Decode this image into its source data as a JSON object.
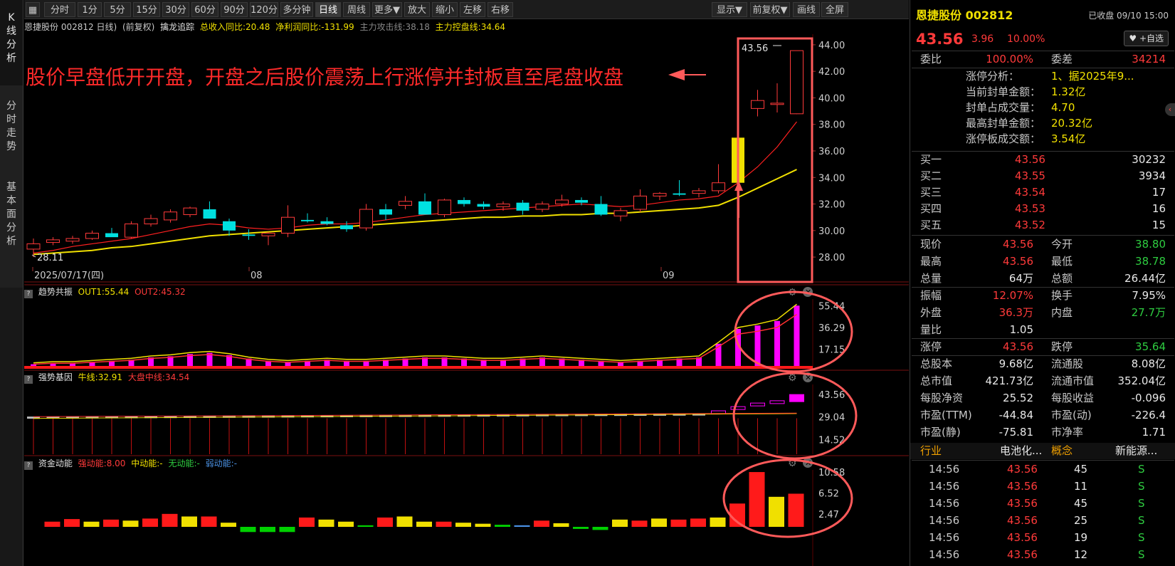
{
  "side_tabs": [
    {
      "label": "K线分析",
      "chars": [
        "K",
        "线",
        "分",
        "析"
      ]
    },
    {
      "label": "分时走势",
      "chars": [
        "分",
        "时",
        "走",
        "势"
      ]
    },
    {
      "label": "基本面分析",
      "chars": [
        "基",
        "本",
        "面",
        "分",
        "析"
      ]
    }
  ],
  "toolbar": {
    "left": [
      "分时",
      "1分",
      "5分",
      "15分",
      "30分",
      "60分",
      "90分",
      "120分",
      "多分钟",
      "日线",
      "周线",
      "更多▼",
      "放大",
      "缩小",
      "左移",
      "右移"
    ],
    "right": [
      "显示▼",
      "前复权▼",
      "画线",
      "全屏"
    ],
    "active": "日线"
  },
  "main_info": {
    "name": "恩捷股份 002812 日线)",
    "fq": "(前复权)",
    "indicator": "擒龙追踪",
    "revenue": "总收入同比:20.48",
    "profit": "净利润同比:-131.99",
    "attack": "主力攻击线:38.18",
    "control": "主力控盘线:34.64"
  },
  "annotation": "股价早盘低开开盘，开盘之后股价震荡上行涨停并封板直至尾盘收盘",
  "kline": {
    "y_ticks": [
      "44.00",
      "42.00",
      "40.00",
      "38.00",
      "36.00",
      "34.00",
      "32.00",
      "30.00",
      "28.00"
    ],
    "x_labels": [
      "2025/07/17(四)",
      "08",
      "09"
    ],
    "low_label": "28.11",
    "high_label": "43.56",
    "candles": [
      [
        28.6,
        29.4,
        28.0,
        29.0
      ],
      [
        29.1,
        29.5,
        28.9,
        29.3
      ],
      [
        29.2,
        29.6,
        29.0,
        29.4
      ],
      [
        29.4,
        30.0,
        29.3,
        29.8
      ],
      [
        29.8,
        30.2,
        29.6,
        29.5
      ],
      [
        29.5,
        30.7,
        29.4,
        30.5
      ],
      [
        30.5,
        31.2,
        30.3,
        30.9
      ],
      [
        30.8,
        31.6,
        30.6,
        31.4
      ],
      [
        31.2,
        31.8,
        31.0,
        31.7
      ],
      [
        31.6,
        32.2,
        31.4,
        30.9
      ],
      [
        30.7,
        30.9,
        29.6,
        30.0
      ],
      [
        29.7,
        30.1,
        29.3,
        29.6
      ],
      [
        29.6,
        29.9,
        28.9,
        29.8
      ],
      [
        29.8,
        31.9,
        29.5,
        31.0
      ],
      [
        30.8,
        31.3,
        30.6,
        30.7
      ],
      [
        30.7,
        31.0,
        30.4,
        30.5
      ],
      [
        30.4,
        30.7,
        29.9,
        30.1
      ],
      [
        30.2,
        32.0,
        30.0,
        31.6
      ],
      [
        31.6,
        32.0,
        30.8,
        31.2
      ],
      [
        31.9,
        32.6,
        31.6,
        32.2
      ],
      [
        32.2,
        32.8,
        31.5,
        31.2
      ],
      [
        31.2,
        32.4,
        31.0,
        32.3
      ],
      [
        32.3,
        32.5,
        31.8,
        32.0
      ],
      [
        32.0,
        32.2,
        31.6,
        31.8
      ],
      [
        31.8,
        32.2,
        31.5,
        32.0
      ],
      [
        32.1,
        32.3,
        31.2,
        31.5
      ],
      [
        31.6,
        32.2,
        31.4,
        32.0
      ],
      [
        32.0,
        32.7,
        31.8,
        32.3
      ],
      [
        32.3,
        32.5,
        31.9,
        32.1
      ],
      [
        32.0,
        32.6,
        31.1,
        31.2
      ],
      [
        31.1,
        31.7,
        30.7,
        31.5
      ],
      [
        31.6,
        33.1,
        31.4,
        32.6
      ],
      [
        32.6,
        32.9,
        32.3,
        32.8
      ],
      [
        32.8,
        33.8,
        32.6,
        32.7
      ],
      [
        32.8,
        33.2,
        32.5,
        33.0
      ],
      [
        33.0,
        35.0,
        32.8,
        33.6
      ],
      [
        33.6,
        37.0,
        33.5,
        37.0
      ],
      [
        39.2,
        40.6,
        38.6,
        39.8
      ],
      [
        39.5,
        41.1,
        38.9,
        39.6
      ],
      [
        38.8,
        43.56,
        38.78,
        43.56
      ]
    ],
    "ma_red": [
      28.3,
      28.5,
      28.8,
      29.0,
      29.2,
      29.4,
      29.7,
      30.0,
      30.3,
      30.5,
      30.4,
      30.2,
      30.1,
      30.2,
      30.4,
      30.5,
      30.5,
      30.6,
      30.8,
      31.0,
      31.2,
      31.3,
      31.4,
      31.5,
      31.6,
      31.7,
      31.8,
      31.9,
      32.0,
      31.9,
      31.8,
      31.9,
      32.1,
      32.3,
      32.4,
      32.6,
      33.6,
      34.8,
      36.3,
      38.2
    ],
    "ma_yellow": [
      28.2,
      28.3,
      28.4,
      28.5,
      28.7,
      28.8,
      29.0,
      29.2,
      29.4,
      29.6,
      29.7,
      29.8,
      29.9,
      30.0,
      30.1,
      30.2,
      30.3,
      30.4,
      30.5,
      30.6,
      30.7,
      30.8,
      30.9,
      31.0,
      31.0,
      31.1,
      31.1,
      31.2,
      31.2,
      31.3,
      31.3,
      31.4,
      31.5,
      31.6,
      31.7,
      31.9,
      32.5,
      33.2,
      33.9,
      34.6
    ]
  },
  "sub1": {
    "name": "趋势共振",
    "out1": "OUT1:55.44",
    "out2": "OUT2:45.32",
    "ticks": [
      "55.44",
      "36.29",
      "17.15"
    ],
    "values": [
      4,
      5,
      5,
      6,
      7,
      8,
      10,
      11,
      13,
      14,
      12,
      9,
      7,
      6,
      7,
      8,
      7,
      7,
      8,
      9,
      10,
      10,
      9,
      8,
      8,
      9,
      10,
      9,
      8,
      7,
      6,
      7,
      8,
      9,
      10,
      22,
      35,
      38,
      42,
      55.44
    ]
  },
  "sub2": {
    "name": "强势基因",
    "niu": "牛线:32.91",
    "dapan": "大盘中线:34.54",
    "ticks": [
      "43.56",
      "29.04",
      "14.52"
    ]
  },
  "sub3": {
    "name": "资金动能",
    "strong": "强动能:8.00",
    "mid": "中动能:-",
    "none": "无动能:-",
    "weak": "弱动能:-",
    "ticks": [
      "10.58",
      "6.52",
      "2.47"
    ],
    "bars": [
      [
        1,
        "#ff1a1a"
      ],
      [
        1.5,
        "#ff1a1a"
      ],
      [
        1,
        "#f0e000"
      ],
      [
        1.4,
        "#ff1a1a"
      ],
      [
        1.2,
        "#f0e000"
      ],
      [
        1.6,
        "#ff1a1a"
      ],
      [
        2.5,
        "#ff1a1a"
      ],
      [
        2,
        "#f0e000"
      ],
      [
        2,
        "#ff1a1a"
      ],
      [
        0.8,
        "#f0e000"
      ],
      [
        -1,
        "#00d000"
      ],
      [
        -1,
        "#00d000"
      ],
      [
        -1,
        "#00d000"
      ],
      [
        1.8,
        "#ff1a1a"
      ],
      [
        1.4,
        "#f0e000"
      ],
      [
        1,
        "#f0e000"
      ],
      [
        0.3,
        "#00d000"
      ],
      [
        1.8,
        "#ff1a1a"
      ],
      [
        2,
        "#f0e000"
      ],
      [
        1,
        "#f0e000"
      ],
      [
        1,
        "#ff1a1a"
      ],
      [
        0.8,
        "#f0e000"
      ],
      [
        0.6,
        "#f0e000"
      ],
      [
        0.4,
        "#00d000"
      ],
      [
        0.3,
        "#4a90e2"
      ],
      [
        1.2,
        "#ff1a1a"
      ],
      [
        0.7,
        "#f0e000"
      ],
      [
        -0.4,
        "#00d000"
      ],
      [
        -0.6,
        "#00d000"
      ],
      [
        1.4,
        "#f0e000"
      ],
      [
        1.2,
        "#ff1a1a"
      ],
      [
        1.6,
        "#f0e000"
      ],
      [
        1.4,
        "#ff1a1a"
      ],
      [
        1.6,
        "#ff1a1a"
      ],
      [
        1.8,
        "#f0e000"
      ],
      [
        4.5,
        "#ff1a1a"
      ],
      [
        10.58,
        "#ff1a1a"
      ],
      [
        5.8,
        "#f0e000"
      ],
      [
        6.4,
        "#ff1a1a"
      ]
    ]
  },
  "quote": {
    "name": "恩捷股份 002812",
    "status": "已收盘 09/10 15:00",
    "price": "43.56",
    "change": "3.96",
    "pct": "10.00%",
    "fav": "+自选",
    "weibi_label": "委比",
    "weibi": "100.00%",
    "weicha_label": "委差",
    "weicha": "34214",
    "analysis": [
      [
        "涨停分析：",
        "1、据2025年9..."
      ],
      [
        "当前封单金额：",
        "1.32亿"
      ],
      [
        "封单占成交量：",
        "4.70"
      ],
      [
        "最高封单金额：",
        "20.32亿"
      ],
      [
        "涨停板成交额：",
        "3.54亿"
      ]
    ],
    "bids": [
      [
        "买一",
        "43.56",
        "30232"
      ],
      [
        "买二",
        "43.55",
        "3934"
      ],
      [
        "买三",
        "43.54",
        "17"
      ],
      [
        "买四",
        "43.53",
        "16"
      ],
      [
        "买五",
        "43.52",
        "15"
      ]
    ],
    "stats": [
      [
        [
          "现价",
          "43.56",
          "red"
        ],
        [
          "今开",
          "38.80",
          "green"
        ]
      ],
      [
        [
          "最高",
          "43.56",
          "red"
        ],
        [
          "最低",
          "38.78",
          "green"
        ]
      ],
      [
        [
          "总量",
          "64万",
          "white"
        ],
        [
          "总额",
          "26.44亿",
          "white"
        ]
      ],
      [
        [
          "振幅",
          "12.07%",
          "red"
        ],
        [
          "换手",
          "7.95%",
          "white"
        ]
      ],
      [
        [
          "外盘",
          "36.3万",
          "red"
        ],
        [
          "内盘",
          "27.7万",
          "green"
        ]
      ],
      [
        [
          "量比",
          "1.05",
          "white"
        ],
        [
          "",
          "",
          " "
        ]
      ],
      [
        [
          "涨停",
          "43.56",
          "red"
        ],
        [
          "跌停",
          "35.64",
          "green"
        ]
      ],
      [
        [
          "总股本",
          "9.68亿",
          "white"
        ],
        [
          "流通股",
          "8.08亿",
          "white"
        ]
      ],
      [
        [
          "总市值",
          "421.73亿",
          "white"
        ],
        [
          "流通市值",
          "352.04亿",
          "white"
        ]
      ],
      [
        [
          "每股净资",
          "25.52",
          "white"
        ],
        [
          "每股收益",
          "-0.096",
          "white"
        ]
      ],
      [
        [
          "市盈(TTM)",
          "-44.84",
          "white"
        ],
        [
          "市盈(动)",
          "-226.4",
          "white"
        ]
      ],
      [
        [
          "市盈(静)",
          "-75.81",
          "white"
        ],
        [
          "市净率",
          "1.71",
          "white"
        ]
      ]
    ],
    "industry_label": "行业",
    "industry": "电池化...",
    "concept_label": "概念",
    "concept": "新能源...",
    "ticks": [
      [
        "14:56",
        "43.56",
        "45",
        "S"
      ],
      [
        "14:56",
        "43.56",
        "11",
        "S"
      ],
      [
        "14:56",
        "43.56",
        "45",
        "S"
      ],
      [
        "14:56",
        "43.56",
        "25",
        "S"
      ],
      [
        "14:56",
        "43.56",
        "19",
        "S"
      ],
      [
        "14:56",
        "43.56",
        "12",
        "S"
      ]
    ]
  },
  "colors": {
    "up": "#ff3a3a",
    "down": "#00e0e0",
    "ma_red": "#ff2020",
    "ma_yellow": "#f0e000",
    "highlight": "#ff5a5a",
    "magenta": "#ff00ff"
  }
}
